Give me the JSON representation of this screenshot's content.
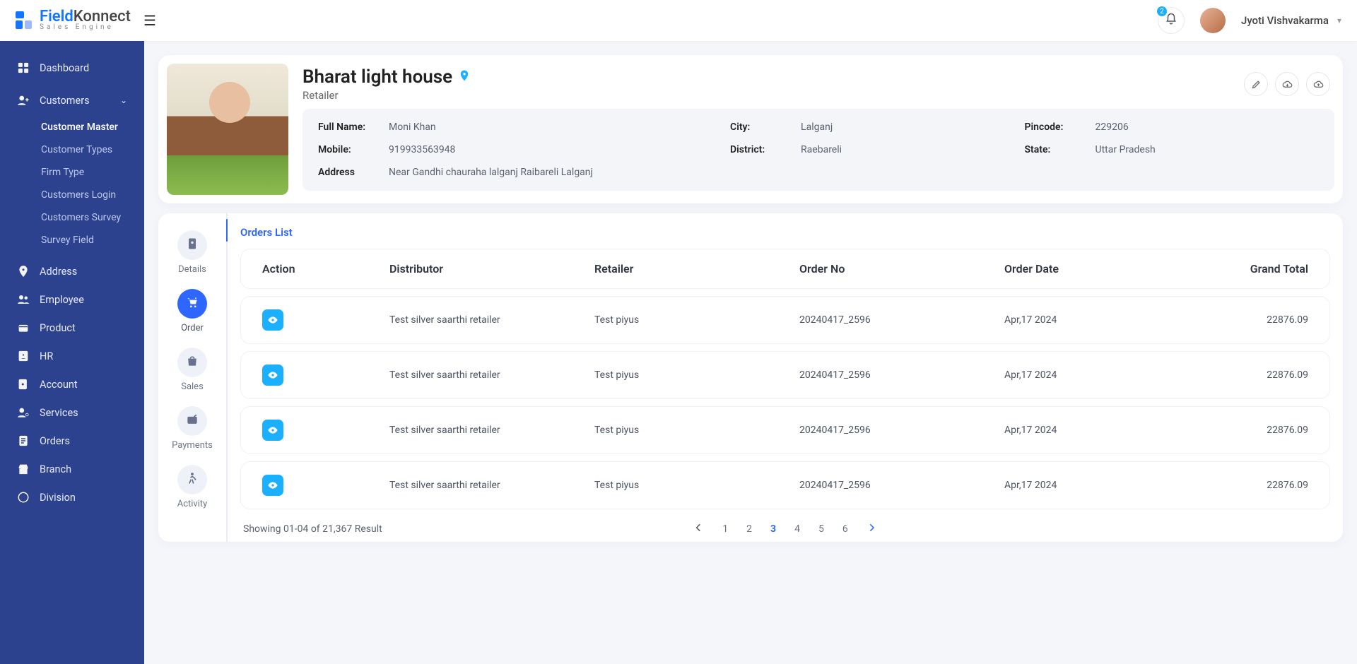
{
  "brand": {
    "main": "Field",
    "second": "Konnect",
    "sub": "Sales Engine"
  },
  "header": {
    "notif_count": "2",
    "user_name": "Jyoti Vishvakarma"
  },
  "sidebar": {
    "dashboard": "Dashboard",
    "customers": "Customers",
    "customers_children": {
      "master": "Customer Master",
      "types": "Customer Types",
      "firm": "Firm Type",
      "login": "Customers Login",
      "survey": "Customers Survey",
      "survey_field": "Survey Field"
    },
    "address": "Address",
    "employee": "Employee",
    "product": "Product",
    "hr": "HR",
    "account": "Account",
    "services": "Services",
    "orders": "Orders",
    "branch": "Branch",
    "division": "Division"
  },
  "profile": {
    "title": "Bharat light house",
    "subtitle": "Retailer",
    "fields": {
      "full_name_label": "Full Name:",
      "full_name": "Moni Khan",
      "mobile_label": "Mobile:",
      "mobile": "919933563948",
      "address_label": "Address",
      "address": "Near Gandhi chauraha lalganj Raibareli Lalganj",
      "city_label": "City:",
      "city": "Lalganj",
      "district_label": "District:",
      "district": "Raebareli",
      "pincode_label": "Pincode:",
      "pincode": "229206",
      "state_label": "State:",
      "state": "Uttar Pradesh"
    }
  },
  "tabs": {
    "details": "Details",
    "order": "Order",
    "sales": "Sales",
    "payments": "Payments",
    "activity": "Activity"
  },
  "orders": {
    "heading": "Orders List",
    "cols": {
      "action": "Action",
      "distributor": "Distributor",
      "retailer": "Retailer",
      "order_no": "Order No",
      "order_date": "Order Date",
      "grand_total": "Grand Total"
    },
    "rows": [
      {
        "distributor": "Test silver saarthi retailer",
        "retailer": "Test piyus",
        "order_no": "20240417_2596",
        "order_date": "Apr,17 2024",
        "grand_total": "22876.09"
      },
      {
        "distributor": "Test silver saarthi retailer",
        "retailer": "Test piyus",
        "order_no": "20240417_2596",
        "order_date": "Apr,17 2024",
        "grand_total": "22876.09"
      },
      {
        "distributor": "Test silver saarthi retailer",
        "retailer": "Test piyus",
        "order_no": "20240417_2596",
        "order_date": "Apr,17 2024",
        "grand_total": "22876.09"
      },
      {
        "distributor": "Test silver saarthi retailer",
        "retailer": "Test piyus",
        "order_no": "20240417_2596",
        "order_date": "Apr,17 2024",
        "grand_total": "22876.09"
      }
    ],
    "pager_text": "Showing 01-04 of  21,367 Result",
    "pages": [
      "1",
      "2",
      "3",
      "4",
      "5",
      "6"
    ],
    "active_page": "3"
  }
}
